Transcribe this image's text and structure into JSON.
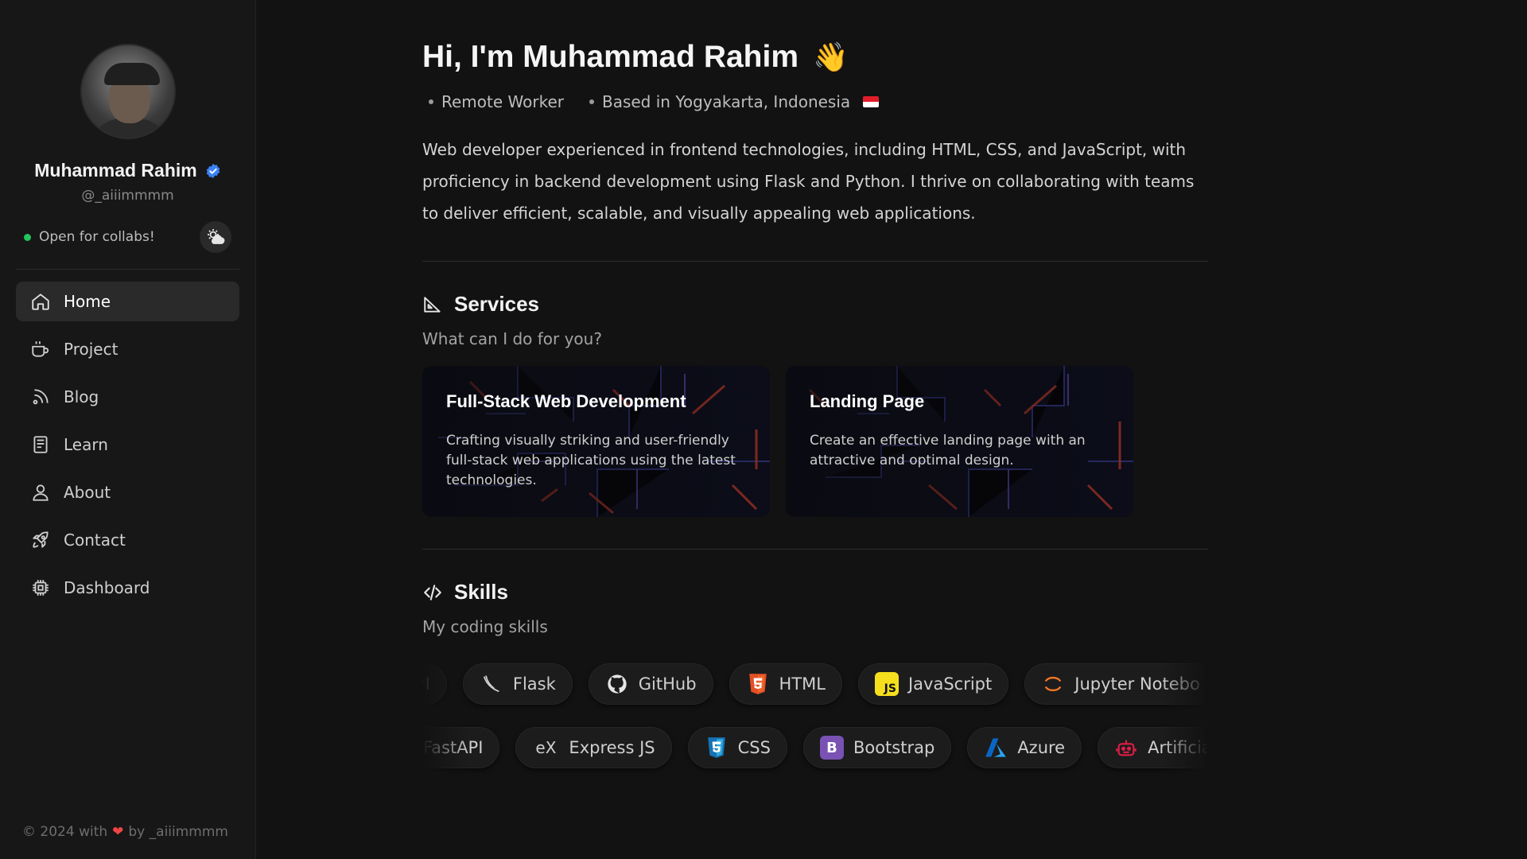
{
  "sidebar": {
    "profile": {
      "name": "Muhammad Rahim",
      "handle": "@_aiiimmmm",
      "status": "Open for collabs!"
    },
    "nav": [
      {
        "label": "Home",
        "icon": "home-icon",
        "active": true
      },
      {
        "label": "Project",
        "icon": "coffee-cup-icon",
        "active": false
      },
      {
        "label": "Blog",
        "icon": "rss-icon",
        "active": false
      },
      {
        "label": "Learn",
        "icon": "book-icon",
        "active": false
      },
      {
        "label": "About",
        "icon": "user-icon",
        "active": false
      },
      {
        "label": "Contact",
        "icon": "rocket-icon",
        "active": false
      },
      {
        "label": "Dashboard",
        "icon": "chip-icon",
        "active": false
      }
    ],
    "footer": {
      "prefix": "© 2024 with",
      "suffix": "by _aiiimmmm"
    }
  },
  "hero": {
    "title": "Hi, I'm Muhammad Rahim",
    "emoji": "👋",
    "meta": [
      "Remote Worker",
      "Based in Yogyakarta, Indonesia"
    ],
    "bio": "Web developer experienced in frontend technologies, including HTML, CSS, and JavaScript, with proficiency in backend development using Flask and Python. I thrive on collaborating with teams to deliver efficient, scalable, and visually appealing web applications."
  },
  "services": {
    "title": "Services",
    "subtitle": "What can I do for you?",
    "cards": [
      {
        "title": "Full-Stack Web Development",
        "desc": "Crafting visually striking and user-friendly full-stack web applications using the latest technologies."
      },
      {
        "title": "Landing Page",
        "desc": "Create an effective landing page with an attractive and optimal design."
      }
    ]
  },
  "skills": {
    "title": "Skills",
    "subtitle": "My coding skills",
    "row1": [
      "PI",
      "Flask",
      "GitHub",
      "HTML",
      "JavaScript",
      "Jupyter Notebo"
    ],
    "row2": [
      "FastAPI",
      "Express JS",
      "CSS",
      "Bootstrap",
      "Azure",
      "Artificial I"
    ]
  },
  "colors": {
    "accent_green": "#22c55e",
    "verified_blue": "#3b82f6",
    "heart_red": "#ef4444"
  }
}
